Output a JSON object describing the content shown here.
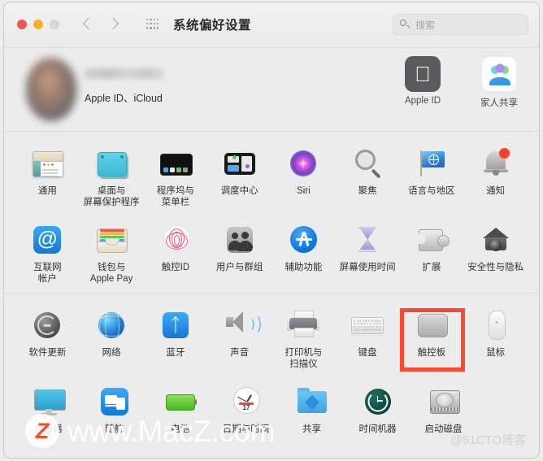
{
  "window": {
    "title": "系统偏好设置",
    "traffic_lights": [
      "close",
      "minimize",
      "zoom"
    ],
    "back_icon": "chevron-left-icon",
    "forward_icon": "chevron-right-icon",
    "grid_icon": "grid-view-icon"
  },
  "search": {
    "placeholder": "搜索",
    "icon": "search-icon",
    "value": ""
  },
  "profile": {
    "name": "",
    "subtitle": "Apple ID、iCloud",
    "avatar_icon": "avatar",
    "tiles": [
      {
        "label": "Apple ID",
        "icon": "apple-logo-icon"
      },
      {
        "label": "家人共享",
        "icon": "family-sharing-icon"
      }
    ]
  },
  "sections": [
    {
      "rows": [
        [
          {
            "label": "通用",
            "icon": "general-icon"
          },
          {
            "label": "桌面与\n屏幕保护程序",
            "icon": "desktop-screensaver-icon"
          },
          {
            "label": "程序坞与\n菜单栏",
            "icon": "dock-menubar-icon"
          },
          {
            "label": "调度中心",
            "icon": "mission-control-icon"
          },
          {
            "label": "Siri",
            "icon": "siri-icon"
          },
          {
            "label": "聚焦",
            "icon": "spotlight-icon"
          },
          {
            "label": "语言与地区",
            "icon": "language-region-icon"
          },
          {
            "label": "通知",
            "icon": "notifications-bell-icon",
            "badge": true
          }
        ],
        [
          {
            "label": "互联网\n帐户",
            "icon": "internet-accounts-icon"
          },
          {
            "label": "钱包与\nApple Pay",
            "icon": "wallet-applepay-icon"
          },
          {
            "label": "触控ID",
            "icon": "touch-id-icon"
          },
          {
            "label": "用户与群组",
            "icon": "users-groups-icon"
          },
          {
            "label": "辅助功能",
            "icon": "accessibility-icon"
          },
          {
            "label": "屏幕使用时间",
            "icon": "screen-time-icon"
          },
          {
            "label": "扩展",
            "icon": "extensions-icon"
          },
          {
            "label": "安全性与隐私",
            "icon": "security-privacy-icon"
          }
        ]
      ]
    },
    {
      "rows": [
        [
          {
            "label": "软件更新",
            "icon": "software-update-icon"
          },
          {
            "label": "网络",
            "icon": "network-icon"
          },
          {
            "label": "蓝牙",
            "icon": "bluetooth-icon"
          },
          {
            "label": "声音",
            "icon": "sound-icon"
          },
          {
            "label": "打印机与\n扫描仪",
            "icon": "printers-scanners-icon"
          },
          {
            "label": "键盘",
            "icon": "keyboard-icon"
          },
          {
            "label": "触控板",
            "icon": "trackpad-icon",
            "highlighted": true
          },
          {
            "label": "鼠标",
            "icon": "mouse-icon"
          }
        ],
        [
          {
            "label": "显示器",
            "icon": "displays-icon"
          },
          {
            "label": "随航",
            "icon": "sidecar-icon"
          },
          {
            "label": "电池",
            "icon": "battery-icon"
          },
          {
            "label": "日期与时间",
            "icon": "date-time-icon"
          },
          {
            "label": "共享",
            "icon": "sharing-icon"
          },
          {
            "label": "时间机器",
            "icon": "time-machine-icon"
          },
          {
            "label": "启动磁盘",
            "icon": "startup-disk-icon"
          }
        ]
      ]
    }
  ],
  "clock": {
    "date": "17"
  },
  "watermarks": {
    "main_logo": "Z",
    "main_text": "www.MacZ.com",
    "corner": "@51CTO博客"
  },
  "colors": {
    "highlight": "#fa4b32",
    "window_bg": "#ececec",
    "badge_red": "#f8402c"
  }
}
